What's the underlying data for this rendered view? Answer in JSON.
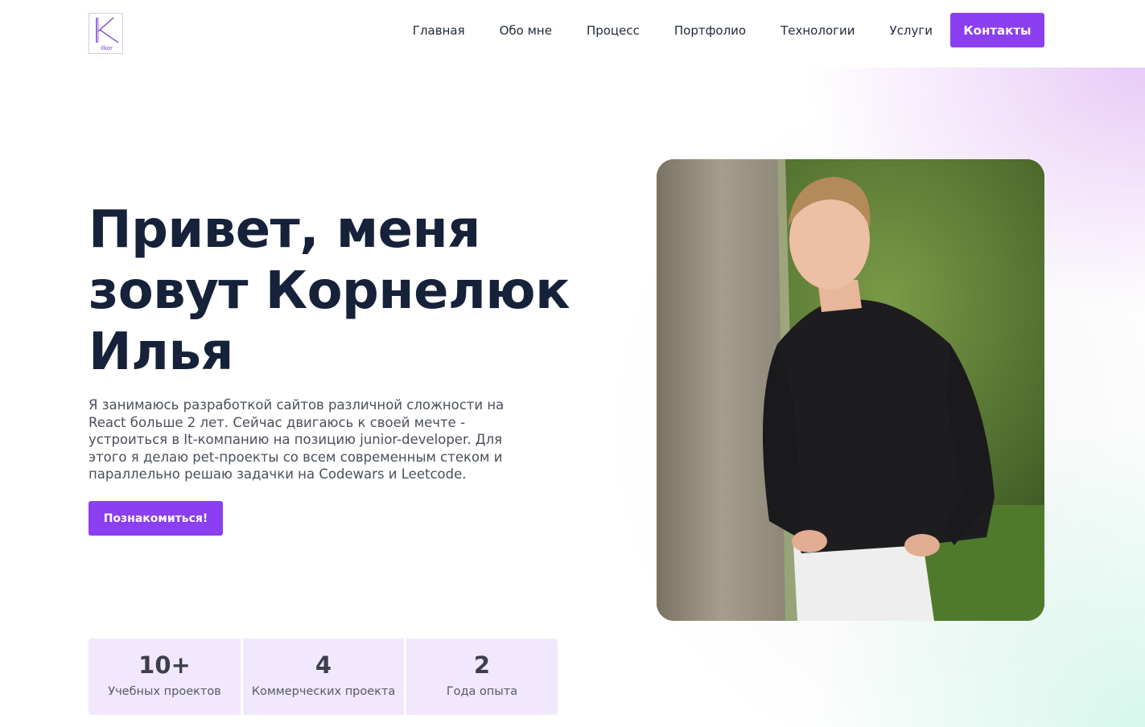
{
  "logo": {
    "letter": "K",
    "caption": "ilkor"
  },
  "nav": {
    "items": [
      "Главная",
      "Обо мне",
      "Процесс",
      "Портфолио",
      "Технологии",
      "Услуги"
    ],
    "cta": "Контакты"
  },
  "hero": {
    "title": "Привет, меня зовут Корнелюк Илья",
    "description": "Я занимаюсь разработкой сайтов различной сложности на React больше 2 лет. Сейчас двигаюсь к своей мечте - устроиться в It-компанию на позицию junior-developer. Для этого я делаю pet-проекты со всем современным стеком и параллельно решаю задачки на Codewars и Leetcode.",
    "button": "Познакомиться!"
  },
  "stats": [
    {
      "value": "10+",
      "label": "Учебных проектов"
    },
    {
      "value": "4",
      "label": "Коммерческих проекта"
    },
    {
      "value": "2",
      "label": "Года опыта"
    }
  ],
  "colors": {
    "accent": "#8b3ff0",
    "heading": "#16213a",
    "stat_bg": "#f1e8fd"
  }
}
